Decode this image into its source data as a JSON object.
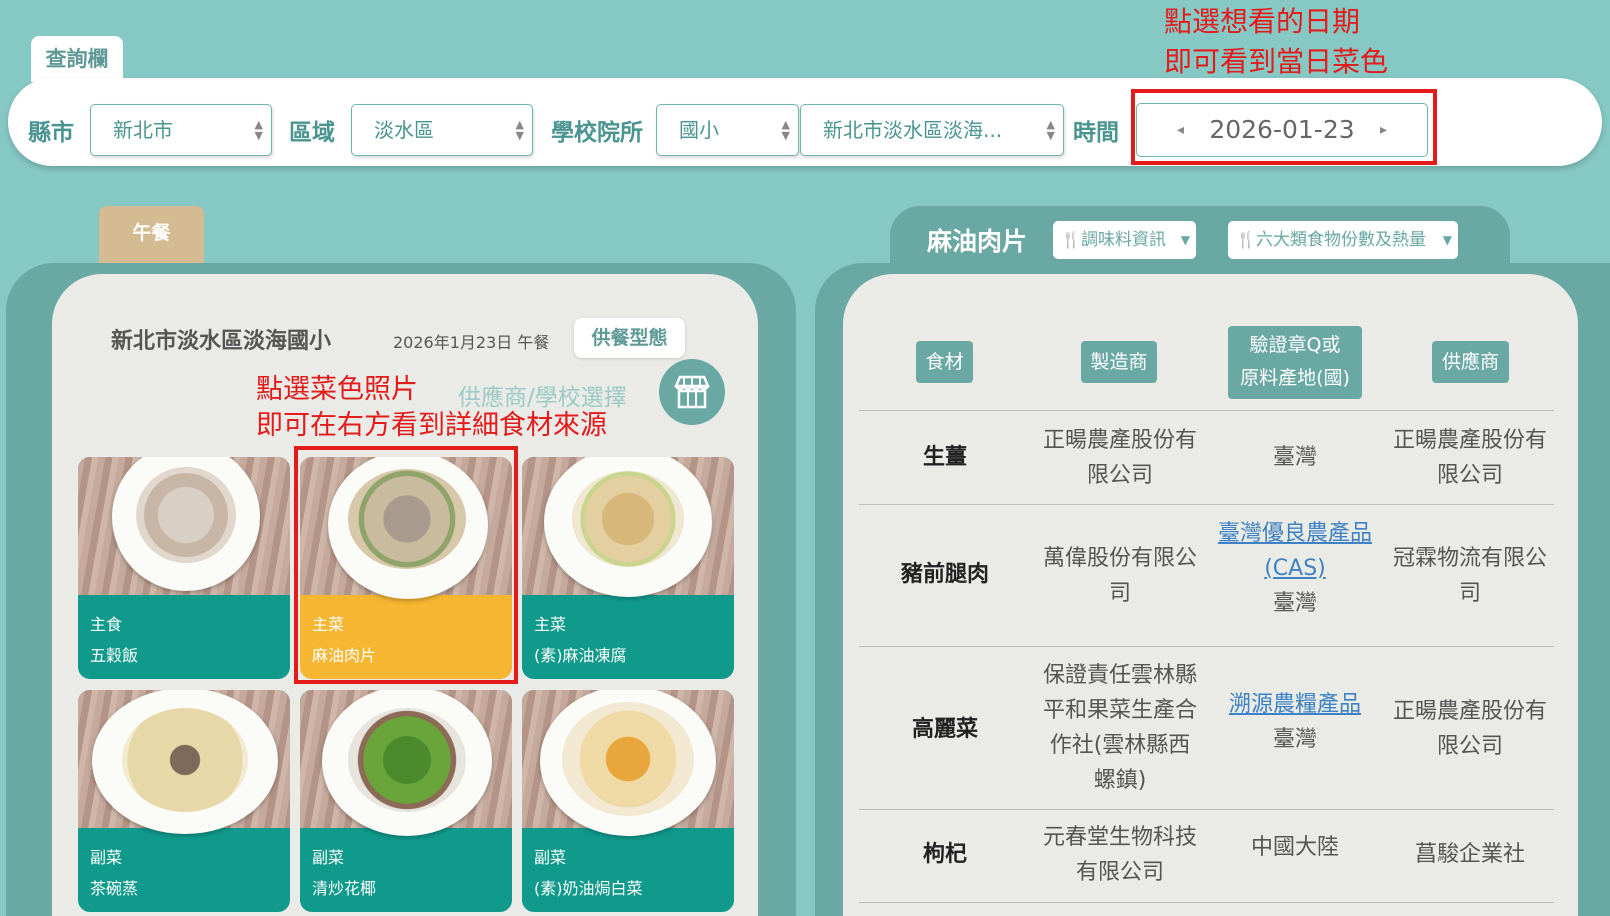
{
  "query": {
    "tab_label": "查詢欄",
    "city_label": "縣市",
    "city_value": "新北市",
    "district_label": "區域",
    "district_value": "淡水區",
    "school_label": "學校院所",
    "school_type_value": "國小",
    "school_value": "新北市淡水區淡海...",
    "time_label": "時間",
    "date_value": "2026-01-23",
    "prev_symbol": "◂",
    "next_symbol": "▸"
  },
  "annotations": {
    "date_hint_line1": "點選想看的日期",
    "date_hint_line2": "即可看到當日菜色",
    "photo_hint_line1": "點選菜色照片",
    "photo_hint_line2": "即可在右方看到詳細食材來源"
  },
  "meal_tab": "午餐",
  "left_panel": {
    "school_name": "新北市淡水區淡海國小",
    "date_meal": "2026年1月23日 午餐",
    "mode_button": "供餐型態",
    "supplier_select": "供應商/學校選擇"
  },
  "dishes": [
    {
      "category": "主食",
      "name": "五穀飯",
      "active": false
    },
    {
      "category": "主菜",
      "name": "麻油肉片",
      "active": true
    },
    {
      "category": "主菜",
      "name": "(素)麻油凍腐",
      "active": false
    },
    {
      "category": "副菜",
      "name": "茶碗蒸",
      "active": false
    },
    {
      "category": "副菜",
      "name": "清炒花椰",
      "active": false
    },
    {
      "category": "副菜",
      "name": "(素)奶油焗白菜",
      "active": false
    }
  ],
  "right_panel": {
    "dish_title": "麻油肉片",
    "dropdown_seasoning": "調味料資訊",
    "dropdown_nutrition": "六大類食物份數及熱量",
    "headers": {
      "ingredient": "食材",
      "manufacturer": "製造商",
      "cert_line1": "驗證章Q或",
      "cert_line2": "原料產地(國)",
      "supplier": "供應商"
    },
    "rows": [
      {
        "ingredient": "生薑",
        "manufacturer_lines": [
          "正暘農產股份有",
          "限公司"
        ],
        "cert_link": "",
        "origin": "臺灣",
        "supplier_lines": [
          "正暘農產股份有",
          "限公司"
        ]
      },
      {
        "ingredient": "豬前腿肉",
        "manufacturer_lines": [
          "萬偉股份有限公",
          "司"
        ],
        "cert_link_lines": [
          "臺灣優良農產品",
          "(CAS)"
        ],
        "origin": "臺灣",
        "supplier_lines": [
          "冠霖物流有限公",
          "司"
        ]
      },
      {
        "ingredient": "高麗菜",
        "manufacturer_lines": [
          "保證責任雲林縣",
          "平和果菜生產合",
          "作社(雲林縣西",
          "螺鎮)"
        ],
        "cert_link_lines": [
          "溯源農糧產品"
        ],
        "origin": "臺灣",
        "supplier_lines": [
          "正暘農產股份有",
          "限公司"
        ]
      },
      {
        "ingredient": "枸杞",
        "manufacturer_lines": [
          "元春堂生物科技",
          "有限公司"
        ],
        "cert_link": "",
        "origin": "中國大陸",
        "supplier_lines": [
          "菖駿企業社"
        ]
      }
    ]
  },
  "colors": {
    "background": "#86c8c4",
    "teal_dark": "#6aa8a3",
    "card_teal": "#0f9a8c",
    "card_active": "#f6b631",
    "highlight_red": "#e31b1b",
    "meal_tab": "#d4bb91"
  }
}
